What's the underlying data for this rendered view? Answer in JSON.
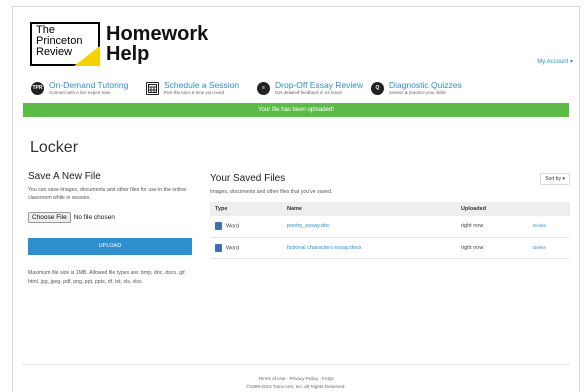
{
  "logo": {
    "line1": "The",
    "line2": "Princeton",
    "line3": "Review",
    "product_line1": "Homework",
    "product_line2": "Help"
  },
  "account": {
    "label": "My Account ▾"
  },
  "nav": [
    {
      "title": "On-Demand Tutoring",
      "sub": "Connect with a live expert now",
      "icon": "tpr-icon"
    },
    {
      "title": "Schedule a Session",
      "sub": "Pick the tutor & time you need",
      "icon": "calendar-icon"
    },
    {
      "title": "Drop-Off Essay Review",
      "sub": "Get detailed feedback in 24 hours",
      "icon": "essay-icon"
    },
    {
      "title": "Diagnostic Quizzes",
      "sub": "Assess & practice your skills",
      "icon": "quiz-icon"
    }
  ],
  "banner": "Your file has been uploaded!",
  "page_title": "Locker",
  "save_new": {
    "heading": "Save A New File",
    "desc": "You can save images, documents and other files for use in the online classroom while in session.",
    "choose_label": "Choose File",
    "no_file": "No file chosen",
    "upload_label": "UPLOAD",
    "note": "Maximum file size is 1MB. Allowed file types are: bmp, doc, docx, gif, html, jpg, jpeg, pdf, png, ppt, pptx, rtf, txt, xls, xlsx."
  },
  "saved": {
    "heading": "Your Saved Files",
    "sub": "Images, documents and other files that you've saved.",
    "sort_label": "Sort by ▾",
    "columns": [
      "Type",
      "Name",
      "Uploaded",
      ""
    ],
    "rows": [
      {
        "type": "Word",
        "name": "poetry_essay.doc",
        "uploaded": "right now",
        "action": "Delete"
      },
      {
        "type": "Word",
        "name": "fictional characters essay.docx",
        "uploaded": "right now",
        "action": "Delete"
      }
    ]
  },
  "footer": {
    "links": "Terms of Use · Privacy Policy · FAQs",
    "copy": "©1999-2016 Tutor.com, Inc. All Rights Reserved."
  },
  "colors": {
    "accent": "#2e8fcf",
    "success": "#5cba47",
    "logo_yellow": "#f6d200"
  }
}
